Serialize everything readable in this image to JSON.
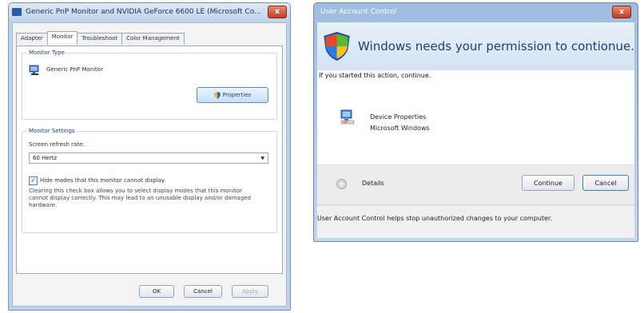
{
  "monitor_dialog": {
    "title": "Generic PnP Monitor and NVIDIA GeForce 6600 LE (Microsoft Co...",
    "close_label": "x",
    "tabs": [
      "Adapter",
      "Monitor",
      "Troubleshoot",
      "Color Management"
    ],
    "monitor_type": {
      "group_label": "Monitor Type",
      "monitor_name": "Generic PnP Monitor",
      "properties_label": "Properties"
    },
    "monitor_settings": {
      "group_label": "Monitor Settings",
      "refresh_label": "Screen refresh rate:",
      "refresh_value": "60 Hertz",
      "hide_modes_checked": true,
      "hide_modes_label": "Hide modes that this monitor cannot display",
      "description": "Clearing this check box allows you to select display modes that this monitor cannot display correctly. This may lead to an unusable display and/or damaged hardware."
    },
    "buttons": {
      "ok": "OK",
      "cancel": "Cancel",
      "apply": "Apply"
    }
  },
  "uac_dialog": {
    "title": "User Account Control",
    "close_label": "x",
    "heading": "Windows needs your permission to contionue.",
    "intro": "If you started this action, continue.",
    "program_name": "Device Properties",
    "program_publisher": "Microsoft Windows",
    "details_label": "Details",
    "continue_label": "Continue",
    "cancel_label": "Cancel",
    "footer": "User Account Control helps stop unauthorized changes to your computer."
  }
}
